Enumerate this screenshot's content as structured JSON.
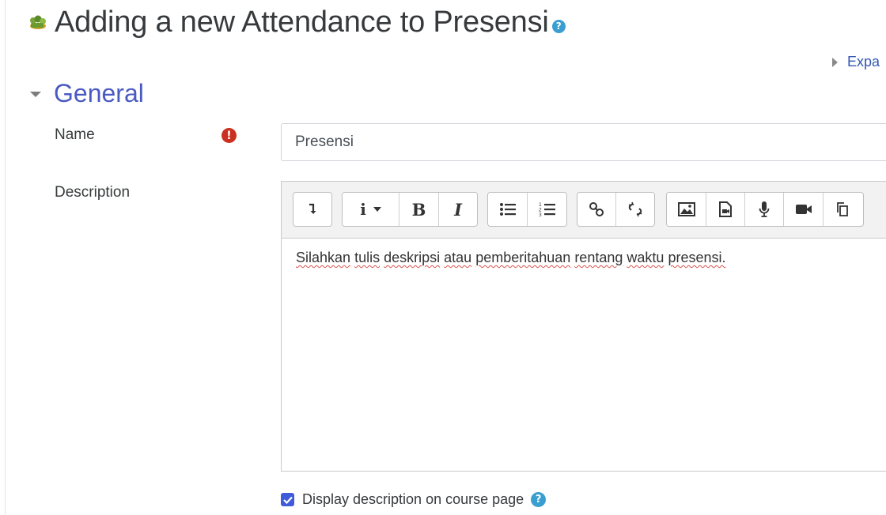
{
  "page": {
    "heading": "Adding a new Attendance to Presensi",
    "expand_all": "Expa"
  },
  "icons": {
    "module": "attendance-module-icon",
    "heading_help": "help-icon",
    "required": "required-icon",
    "section_collapse": "caret-down-icon",
    "expand": "caret-right-icon",
    "checkbox_help": "help-icon"
  },
  "colors": {
    "accent_link": "#3358b3",
    "section_title": "#4a5ac0",
    "help_icon": "#3a9ed0",
    "required_icon": "#ca3120",
    "checkbox": "#3f5bd9"
  },
  "general": {
    "title": "General",
    "name_label": "Name",
    "name_value": "Presensi",
    "description_label": "Description",
    "description_words": [
      "Silahkan",
      "tulis",
      "deskripsi",
      "atau",
      "pemberitahuan",
      "rentang",
      "waktu",
      "presensi."
    ],
    "toolbar": [
      [
        "collapse-toolbar"
      ],
      [
        "paragraph-style",
        "bold",
        "italic"
      ],
      [
        "unordered-list",
        "ordered-list"
      ],
      [
        "insert-link",
        "remove-link"
      ],
      [
        "insert-image",
        "insert-media",
        "record-audio",
        "record-video",
        "manage-files"
      ]
    ],
    "toolbar_text": {
      "style": "i",
      "bold": "B",
      "italic": "I"
    },
    "display_description_label": "Display description on course page",
    "display_description_checked": true
  }
}
